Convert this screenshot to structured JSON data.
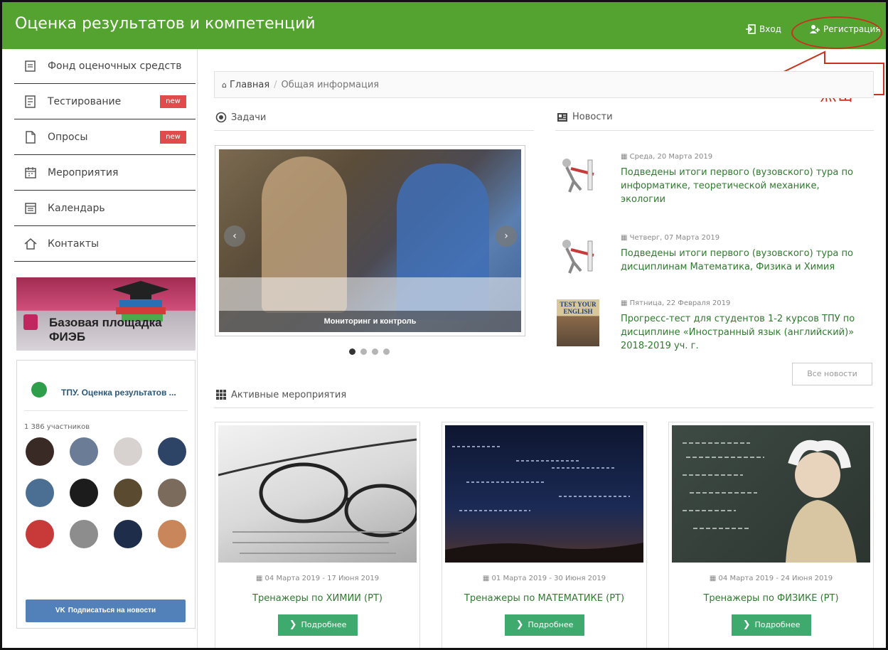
{
  "header": {
    "title": "Оценка результатов и компетенций",
    "login": "Вход",
    "register": "Регистрация",
    "annotation": "点击"
  },
  "colors": {
    "brand_green": "#54a330",
    "link_green": "#2f7a2f",
    "badge_red": "#e04b4b",
    "button_green": "#3faa6e",
    "vk_blue": "#5181b8",
    "annotation_red": "#c8321e"
  },
  "sidebar": {
    "items": [
      {
        "label": "Фонд оценочных средств",
        "icon": "document-icon",
        "badge": ""
      },
      {
        "label": "Тестирование",
        "icon": "test-icon",
        "badge": "new"
      },
      {
        "label": "Опросы",
        "icon": "survey-icon",
        "badge": "new"
      },
      {
        "label": "Мероприятия",
        "icon": "events-icon",
        "badge": ""
      },
      {
        "label": "Календарь",
        "icon": "calendar-icon",
        "badge": ""
      },
      {
        "label": "Контакты",
        "icon": "home-icon",
        "badge": ""
      }
    ],
    "banner_text": "Базовая площадка ФИЭБ",
    "vk": {
      "group_name": "ТПУ. Оценка результатов ...",
      "members": "1 386 участников",
      "subscribe": "Подписаться на новости"
    }
  },
  "breadcrumb": {
    "home": "Главная",
    "separator": "/",
    "current": "Общая информация"
  },
  "sections": {
    "tasks": "Задачи",
    "news": "Новости",
    "active_events": "Активные мероприятия"
  },
  "carousel": {
    "caption": "Мониторинг и контроль",
    "prev": "‹",
    "next": "›",
    "active_index": 0
  },
  "news": {
    "items": [
      {
        "date": "Среда, 20 Марта 2019",
        "title": "Подведены итоги первого (вузовского) тура по информатике, теоретической механике, экологии"
      },
      {
        "date": "Четверг, 07 Марта 2019",
        "title": "Подведены итоги первого (вузовского) тура по дисциплинам Математика, Физика и Химия"
      },
      {
        "date": "Пятница, 22 Февраля 2019",
        "title": "Прогресс-тест для студентов 1-2 курсов ТПУ по дисциплине «Иностранный язык (английский)» 2018-2019 уч. г."
      }
    ],
    "thumb3_text": "TEST YOUR ENGLISH",
    "all_news": "Все новости"
  },
  "events": [
    {
      "date": "04 Марта 2019 - 17 Июня 2019",
      "title": "Тренажеры по ХИМИИ (РТ)",
      "button": "Подробнее"
    },
    {
      "date": "01 Марта 2019 - 30 Июня 2019",
      "title": "Тренажеры по МАТЕМАТИКЕ (РТ)",
      "button": "Подробнее"
    },
    {
      "date": "04 Марта 2019 - 24 Июня 2019",
      "title": "Тренажеры по ФИЗИКЕ (РТ)",
      "button": "Подробнее"
    }
  ]
}
